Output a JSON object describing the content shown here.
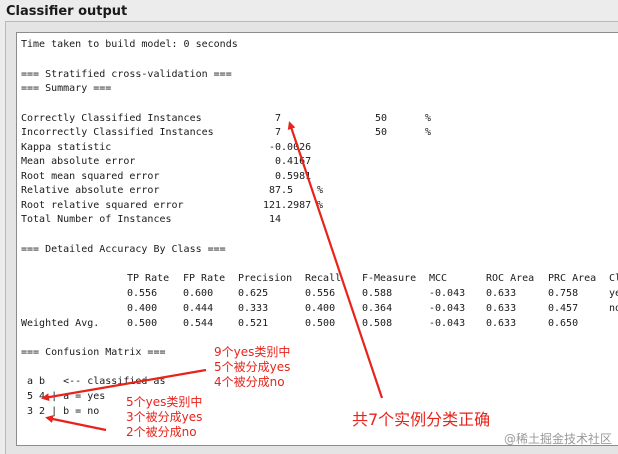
{
  "window": {
    "title": "Classifier output"
  },
  "output": {
    "time_line": "Time taken to build model: 0 seconds",
    "section_cv": "=== Stratified cross-validation ===",
    "section_summary": "=== Summary ===",
    "summary": [
      {
        "label": "Correctly Classified Instances",
        "value": "7",
        "pct": "50",
        "unit": "%"
      },
      {
        "label": "Incorrectly Classified Instances",
        "value": "7",
        "pct": "50",
        "unit": "%"
      },
      {
        "label": "Kappa statistic",
        "value": "-0.0026",
        "pct": "",
        "unit": ""
      },
      {
        "label": "Mean absolute error",
        "value": "0.4167",
        "pct": "",
        "unit": ""
      },
      {
        "label": "Root mean squared error",
        "value": "0.5981",
        "pct": "",
        "unit": ""
      },
      {
        "label": "Relative absolute error",
        "value": "87.5",
        "pct": "",
        "unit": "%"
      },
      {
        "label": "Root relative squared error",
        "value": "121.2987",
        "pct": "",
        "unit": "%"
      },
      {
        "label": "Total Number of Instances",
        "value": "14",
        "pct": "",
        "unit": ""
      }
    ],
    "section_detailed": "=== Detailed Accuracy By Class ===",
    "accuracy_headers": [
      "TP Rate",
      "FP Rate",
      "Precision",
      "Recall",
      "F-Measure",
      "MCC",
      "ROC Area",
      "PRC Area",
      "Class"
    ],
    "accuracy_rows": [
      {
        "label": "",
        "values": [
          "0.556",
          "0.600",
          "0.625",
          "0.556",
          "0.588",
          "-0.043",
          "0.633",
          "0.758",
          "yes"
        ]
      },
      {
        "label": "",
        "values": [
          "0.400",
          "0.444",
          "0.333",
          "0.400",
          "0.364",
          "-0.043",
          "0.633",
          "0.457",
          "no"
        ]
      },
      {
        "label": "Weighted Avg.",
        "values": [
          "0.500",
          "0.544",
          "0.521",
          "0.500",
          "0.508",
          "-0.043",
          "0.633",
          "0.650",
          ""
        ]
      }
    ],
    "section_confusion": "=== Confusion Matrix ===",
    "confusion_lines": [
      "a b   <-- classified as",
      "5 4 | a = yes",
      "3 2 | b = no"
    ]
  },
  "annotations": {
    "row_a": [
      "9个yes类别中",
      "5个被分成yes",
      "4个被分成no"
    ],
    "row_b": [
      "5个yes类别中",
      "3个被分成yes",
      "2个被分成no"
    ],
    "total": "共7个实例分类正确",
    "color": "#e8231b"
  },
  "watermark": "@稀土掘金技术社区"
}
